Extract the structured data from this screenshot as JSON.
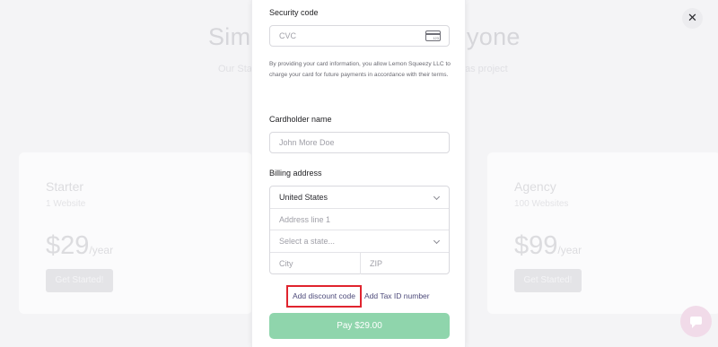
{
  "background": {
    "hero_title_left": "Sim",
    "hero_title_right": "yone",
    "hero_sub_left": "Our Sta",
    "hero_sub_right": "as project",
    "plans": [
      {
        "name": "Starter",
        "sub": "1 Website",
        "price": "$29",
        "period": "/year",
        "button": "Get Started!"
      },
      {
        "name": "Agency",
        "sub": "100 Websites",
        "price": "$99",
        "period": "/year",
        "button": "Get Started!"
      }
    ]
  },
  "checkout": {
    "security_code_label": "Security code",
    "cvc_placeholder": "CVC",
    "card_icon_text": "123",
    "terms": "By providing your card information, you allow Lemon Squeezy LLC to charge your card for future payments in accordance with their terms.",
    "cardholder_label": "Cardholder name",
    "cardholder_placeholder": "John More Doe",
    "billing_label": "Billing address",
    "country_value": "United States",
    "address_placeholder": "Address line 1",
    "state_placeholder": "Select a state...",
    "city_placeholder": "City",
    "zip_placeholder": "ZIP",
    "discount_link": "Add discount code",
    "tax_link": "Add Tax ID number",
    "pay_button": "Pay $29.00"
  },
  "close_label": "✕",
  "colors": {
    "pay_button": "#8fd5ac",
    "highlight_border": "#e0242e",
    "link": "#4d4a7a",
    "chat_bubble": "#f1dbe9"
  }
}
